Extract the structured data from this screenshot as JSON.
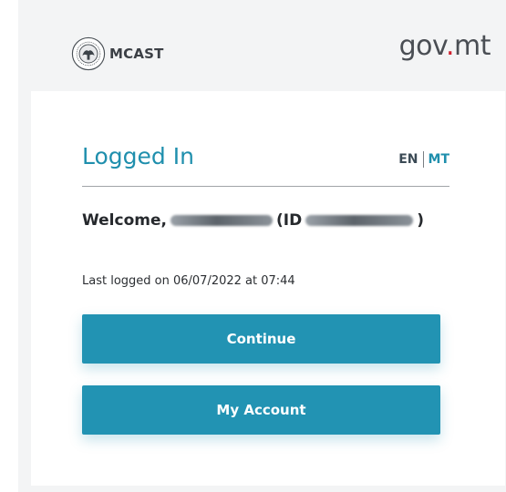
{
  "header": {
    "brand_name": "MCAST",
    "logo_icon": "mcast-seal-icon",
    "gov_prefix": "gov",
    "gov_dot": ".",
    "gov_suffix": "mt"
  },
  "card": {
    "title": "Logged In",
    "lang": {
      "en": "EN",
      "mt": "MT"
    },
    "welcome_prefix": "Welcome,",
    "id_prefix": "(ID",
    "id_suffix": ")",
    "last_logged": "Last logged on 06/07/2022 at 07:44",
    "continue_label": "Continue",
    "account_label": "My Account"
  },
  "colors": {
    "accent": "#2293b3",
    "title": "#1f8fad",
    "gov_dot": "#d0202e"
  }
}
